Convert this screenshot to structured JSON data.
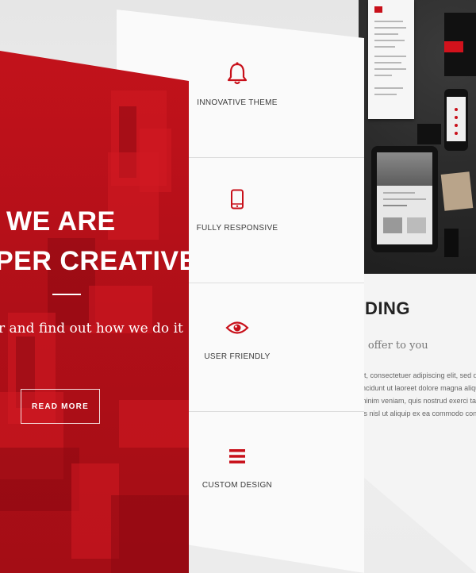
{
  "hero": {
    "heading_line1": "WE ARE",
    "heading_line2": "PER CREATIVE",
    "subtitle": "r and find out how we do it",
    "button_label": "READ MORE"
  },
  "features": [
    {
      "label": "INNOVATIVE THEME",
      "icon": "bell-icon"
    },
    {
      "label": "FULLY RESPONSIVE",
      "icon": "smartphone-icon"
    },
    {
      "label": "USER FRIENDLY",
      "icon": "eye-icon"
    },
    {
      "label": "CUSTOM DESIGN",
      "icon": "menu-icon"
    }
  ],
  "branding": {
    "title": "DING",
    "subtitle": "e offer to you",
    "body_lines": [
      "et, consectetuer adipiscing elit, sed diam",
      "incidunt ut laoreet dolore magna aliquam erat",
      "minim veniam, quis nostrud exerci tation",
      "tis nisl ut aliquip ex ea commodo consequat."
    ]
  },
  "colors": {
    "accent": "#c8101a",
    "hero_background": "#b00f18",
    "panel_background": "#fafafa",
    "text_dark": "#222222"
  }
}
